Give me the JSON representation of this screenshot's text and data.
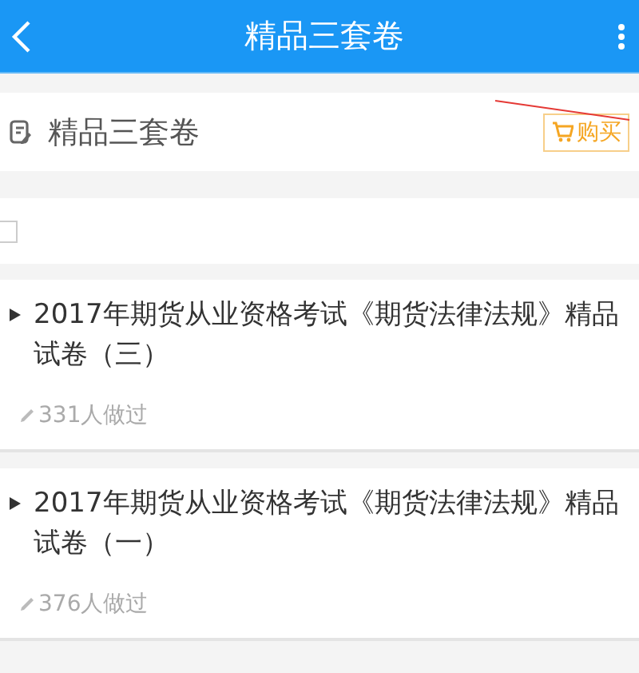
{
  "app_bar": {
    "title": "精品三套卷"
  },
  "section": {
    "title": "精品三套卷",
    "buy_button": "购买"
  },
  "checkbox": {
    "checked": false
  },
  "papers": [
    {
      "title": "2017年期货从业资格考试《期货法律法规》精品试卷（三）",
      "done_count": "331人做过"
    },
    {
      "title": "2017年期货从业资格考试《期货法律法规》精品试卷（一）",
      "done_count": "376人做过"
    }
  ]
}
